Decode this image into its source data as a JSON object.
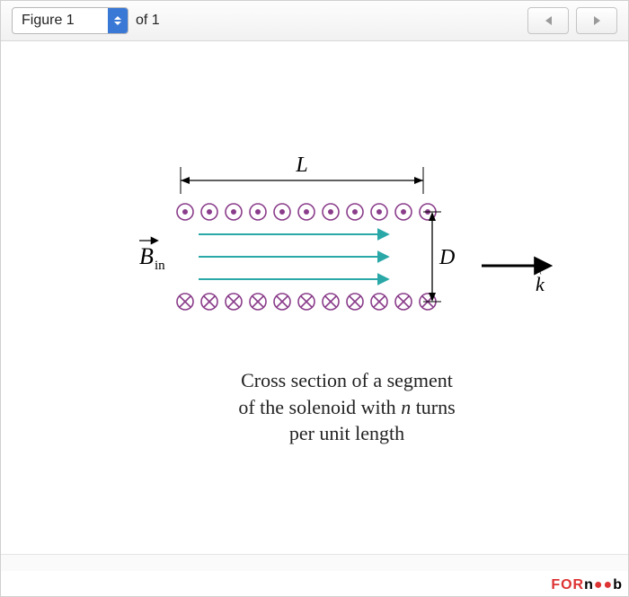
{
  "toolbar": {
    "dropdown_label": "Figure 1",
    "of_text": "of 1"
  },
  "diagram": {
    "length_label": "L",
    "diameter_label": "D",
    "field_label_vector": "B",
    "field_label_sub": "in",
    "axis_label": "k",
    "caption_l1": "Cross section of a segment",
    "caption_l2": "of the solenoid with ",
    "caption_var": "n",
    "caption_l2b": " turns",
    "caption_l3": "per unit length"
  },
  "watermark": {
    "t1": "FOR",
    "t2": "n",
    "t4": "b"
  }
}
